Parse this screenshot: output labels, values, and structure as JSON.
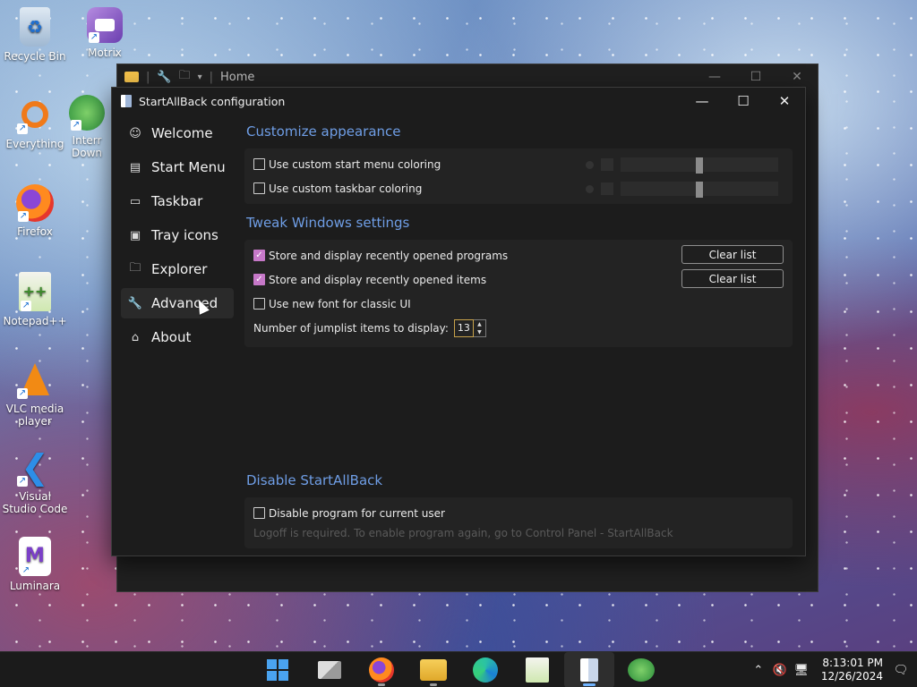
{
  "desktop": {
    "icons": [
      {
        "label": "Recycle Bin",
        "icon": "recycle-bin-icon"
      },
      {
        "label": "Motrix",
        "icon": "motrix-icon"
      },
      {
        "label": "Everything",
        "icon": "everything-search-icon"
      },
      {
        "label": "Interr Down",
        "icon": "internet-download-manager-icon"
      },
      {
        "label": "Firefox",
        "icon": "firefox-icon"
      },
      {
        "label": "Notepad++",
        "icon": "notepad-plus-plus-icon"
      },
      {
        "label": "VLC media player",
        "icon": "vlc-icon"
      },
      {
        "label": "Visual Studio Code",
        "icon": "vscode-icon"
      },
      {
        "label": "Luminara",
        "icon": "luminara-icon"
      }
    ]
  },
  "explorer": {
    "location": "Home"
  },
  "window": {
    "title": "StartAllBack configuration",
    "minimize": "—",
    "maximize": "☐",
    "close": "✕"
  },
  "nav": {
    "items": [
      {
        "label": "Welcome",
        "icon": "smiley-icon",
        "glyph": "☺"
      },
      {
        "label": "Start Menu",
        "icon": "start-menu-icon",
        "glyph": "▤"
      },
      {
        "label": "Taskbar",
        "icon": "taskbar-icon",
        "glyph": "▭"
      },
      {
        "label": "Tray icons",
        "icon": "tray-icon",
        "glyph": "▣"
      },
      {
        "label": "Explorer",
        "icon": "folder-icon",
        "glyph": "🗀"
      },
      {
        "label": "Advanced",
        "icon": "wrench-icon",
        "glyph": "🔧"
      },
      {
        "label": "About",
        "icon": "info-icon",
        "glyph": "⌂"
      }
    ],
    "active": "Advanced"
  },
  "appearance": {
    "title": "Customize appearance",
    "start_menu_coloring": "Use custom start menu coloring",
    "taskbar_coloring": "Use custom taskbar coloring",
    "start_menu_coloring_checked": false,
    "taskbar_coloring_checked": false,
    "slider_level": 0.5
  },
  "tweak": {
    "title": "Tweak Windows settings",
    "recent_programs": "Store and display recently opened programs",
    "recent_items": "Store and display recently opened items",
    "new_font": "Use new font for classic UI",
    "recent_programs_checked": true,
    "recent_items_checked": true,
    "new_font_checked": false,
    "clear_list": "Clear list",
    "jumplist_label": "Number of jumplist items to display:",
    "jumplist_value": "13"
  },
  "disable": {
    "title": "Disable StartAllBack",
    "option": "Disable program for current user",
    "option_checked": false,
    "note": "Logoff is required. To enable program again, go to Control Panel - StartAllBack"
  },
  "taskbar": {
    "apps": [
      "windows-start-icon",
      "task-view-icon",
      "firefox-icon",
      "file-explorer-icon",
      "edge-icon",
      "notepad-plus-plus-icon",
      "startallback-icon",
      "download-manager-icon"
    ],
    "active_app": "startallback-icon",
    "time": "8:13:01 PM",
    "date": "12/26/2024"
  },
  "colors": {
    "accent": "#6f9ee6",
    "check": "#c678c8"
  }
}
